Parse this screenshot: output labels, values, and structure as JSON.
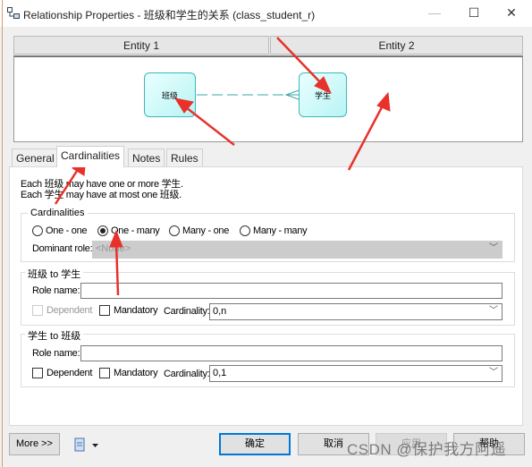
{
  "window": {
    "title": "Relationship Properties - 班级和学生的关系 (class_student_r)",
    "minimize": "—",
    "maximize": "☐",
    "close": "✕"
  },
  "diagram": {
    "entity1_header": "Entity 1",
    "entity2_header": "Entity 2",
    "entity1": "班级",
    "entity2": "学生"
  },
  "tabs": [
    {
      "label": "General"
    },
    {
      "label": "Cardinalities",
      "selected": true
    },
    {
      "label": "Notes"
    },
    {
      "label": "Rules"
    }
  ],
  "description": {
    "line1": "Each 班级 may have one or more 学生.",
    "line2": "Each 学生 may have at most one 班级."
  },
  "cardinalities": {
    "legend": "Cardinalities",
    "options": [
      "One - one",
      "One - many",
      "Many - one",
      "Many - many"
    ],
    "selected": "One - many",
    "dominant_role_label": "Dominant role:",
    "dominant_role_value": "<None>"
  },
  "role1": {
    "legend": "班级 to 学生",
    "role_name_label": "Role name:",
    "role_name_value": "",
    "dependent": "Dependent",
    "dependent_checked": false,
    "dependent_enabled": false,
    "mandatory": "Mandatory",
    "mandatory_checked": false,
    "cardinality_label": "Cardinality:",
    "cardinality_value": "0,n"
  },
  "role2": {
    "legend": "学生 to 班级",
    "role_name_label": "Role name:",
    "role_name_value": "",
    "dependent": "Dependent",
    "dependent_checked": false,
    "dependent_enabled": true,
    "mandatory": "Mandatory",
    "mandatory_checked": false,
    "cardinality_label": "Cardinality:",
    "cardinality_value": "0,1"
  },
  "buttons": {
    "more": "More >>",
    "ok": "确定",
    "cancel": "取消",
    "apply": "应用",
    "help": "帮助"
  },
  "watermark": "CSDN @保护我方阿遥",
  "colors": {
    "entity_border": "#3cb8b8",
    "annotation_arrow": "#e8312a",
    "default_button": "#0078d7"
  }
}
